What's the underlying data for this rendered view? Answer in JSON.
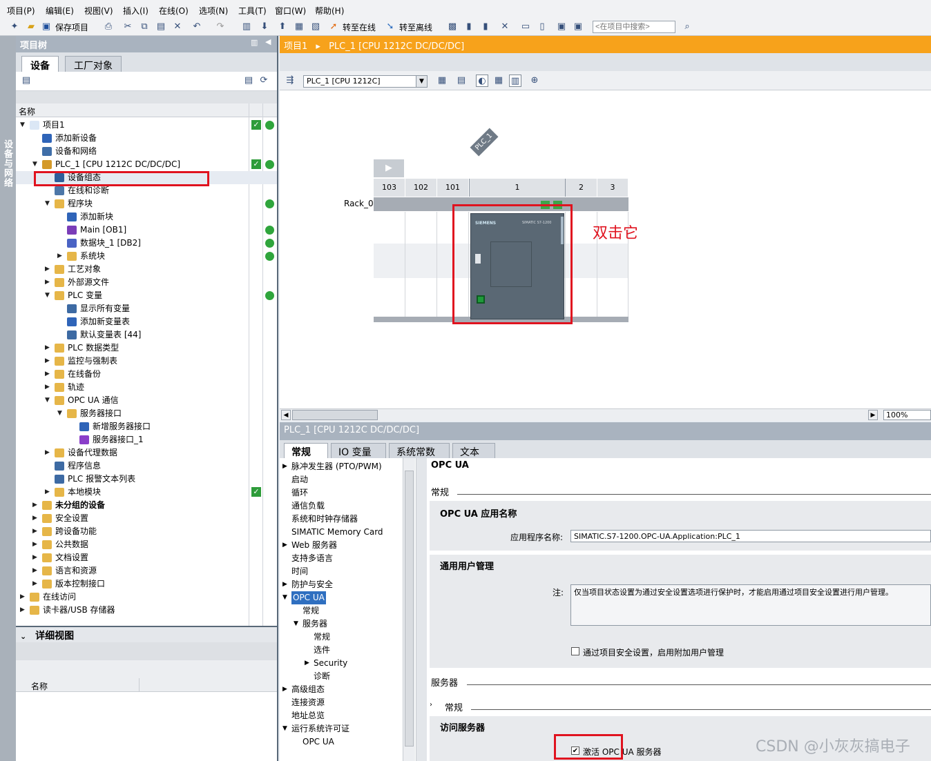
{
  "menu": [
    "项目(P)",
    "编辑(E)",
    "视图(V)",
    "插入(I)",
    "在线(O)",
    "选项(N)",
    "工具(T)",
    "窗口(W)",
    "帮助(H)"
  ],
  "toolbar": {
    "save_label": "保存项目",
    "go_online": "转至在线",
    "go_offline": "转至离线",
    "search_placeholder": "<在项目中搜索>"
  },
  "vstrip_label": "设备与网络",
  "project_tree": {
    "title": "项目树",
    "tab_devices": "设备",
    "tab_plant": "工厂对象",
    "col_name": "名称",
    "rows": [
      {
        "label": "项目1",
        "indent": 0,
        "arrow": "down",
        "icon": "project",
        "st1": true,
        "st2": true
      },
      {
        "label": "添加新设备",
        "indent": 1,
        "arrow": "",
        "icon": "add",
        "st1": false,
        "st2": false
      },
      {
        "label": "设备和网络",
        "indent": 1,
        "arrow": "",
        "icon": "network",
        "st1": false,
        "st2": false
      },
      {
        "label": "PLC_1 [CPU 1212C DC/DC/DC]",
        "indent": 1,
        "arrow": "down",
        "icon": "plc",
        "st1": true,
        "st2": true
      },
      {
        "label": "设备组态",
        "indent": 2,
        "arrow": "",
        "icon": "config",
        "st1": false,
        "st2": false
      },
      {
        "label": "在线和诊断",
        "indent": 2,
        "arrow": "",
        "icon": "diag",
        "st1": false,
        "st2": false
      },
      {
        "label": "程序块",
        "indent": 2,
        "arrow": "down",
        "icon": "folder",
        "st1": false,
        "st2": true
      },
      {
        "label": "添加新块",
        "indent": 3,
        "arrow": "",
        "icon": "add",
        "st1": false,
        "st2": false
      },
      {
        "label": "Main [OB1]",
        "indent": 3,
        "arrow": "",
        "icon": "ob",
        "st1": false,
        "st2": true
      },
      {
        "label": "数据块_1 [DB2]",
        "indent": 3,
        "arrow": "",
        "icon": "db",
        "st1": false,
        "st2": true
      },
      {
        "label": "系统块",
        "indent": 3,
        "arrow": "right",
        "icon": "folder",
        "st1": false,
        "st2": true
      },
      {
        "label": "工艺对象",
        "indent": 2,
        "arrow": "right",
        "icon": "folder",
        "st1": false,
        "st2": false
      },
      {
        "label": "外部源文件",
        "indent": 2,
        "arrow": "right",
        "icon": "folder",
        "st1": false,
        "st2": false
      },
      {
        "label": "PLC 变量",
        "indent": 2,
        "arrow": "down",
        "icon": "folder",
        "st1": false,
        "st2": true
      },
      {
        "label": "显示所有变量",
        "indent": 3,
        "arrow": "",
        "icon": "table",
        "st1": false,
        "st2": false
      },
      {
        "label": "添加新变量表",
        "indent": 3,
        "arrow": "",
        "icon": "add",
        "st1": false,
        "st2": false
      },
      {
        "label": "默认变量表 [44]",
        "indent": 3,
        "arrow": "",
        "icon": "table",
        "st1": false,
        "st2": false
      },
      {
        "label": "PLC 数据类型",
        "indent": 2,
        "arrow": "right",
        "icon": "folder",
        "st1": false,
        "st2": false
      },
      {
        "label": "监控与强制表",
        "indent": 2,
        "arrow": "right",
        "icon": "folder",
        "st1": false,
        "st2": false
      },
      {
        "label": "在线备份",
        "indent": 2,
        "arrow": "right",
        "icon": "folder",
        "st1": false,
        "st2": false
      },
      {
        "label": "轨迹",
        "indent": 2,
        "arrow": "right",
        "icon": "folder",
        "st1": false,
        "st2": false
      },
      {
        "label": "OPC UA 通信",
        "indent": 2,
        "arrow": "down",
        "icon": "folder",
        "st1": false,
        "st2": false
      },
      {
        "label": "服务器接口",
        "indent": 3,
        "arrow": "down",
        "icon": "folder",
        "st1": false,
        "st2": false
      },
      {
        "label": "新增服务器接口",
        "indent": 4,
        "arrow": "",
        "icon": "add",
        "st1": false,
        "st2": false
      },
      {
        "label": "服务器接口_1",
        "indent": 4,
        "arrow": "",
        "icon": "server",
        "st1": false,
        "st2": false
      },
      {
        "label": "设备代理数据",
        "indent": 2,
        "arrow": "right",
        "icon": "folder",
        "st1": false,
        "st2": false
      },
      {
        "label": "程序信息",
        "indent": 2,
        "arrow": "",
        "icon": "table",
        "st1": false,
        "st2": false
      },
      {
        "label": "PLC 报警文本列表",
        "indent": 2,
        "arrow": "",
        "icon": "table",
        "st1": false,
        "st2": false
      },
      {
        "label": "本地模块",
        "indent": 2,
        "arrow": "right",
        "icon": "folder",
        "st1": true,
        "st2": false
      },
      {
        "label": "未分组的设备",
        "indent": 1,
        "arrow": "right",
        "icon": "folder",
        "st1": false,
        "st2": false,
        "bold": true
      },
      {
        "label": "安全设置",
        "indent": 1,
        "arrow": "right",
        "icon": "folder",
        "st1": false,
        "st2": false
      },
      {
        "label": "跨设备功能",
        "indent": 1,
        "arrow": "right",
        "icon": "folder",
        "st1": false,
        "st2": false
      },
      {
        "label": "公共数据",
        "indent": 1,
        "arrow": "right",
        "icon": "folder",
        "st1": false,
        "st2": false
      },
      {
        "label": "文档设置",
        "indent": 1,
        "arrow": "right",
        "icon": "folder",
        "st1": false,
        "st2": false
      },
      {
        "label": "语言和资源",
        "indent": 1,
        "arrow": "right",
        "icon": "folder",
        "st1": false,
        "st2": false
      },
      {
        "label": "版本控制接口",
        "indent": 1,
        "arrow": "right",
        "icon": "folder",
        "st1": false,
        "st2": false
      },
      {
        "label": "在线访问",
        "indent": 0,
        "arrow": "right",
        "icon": "folder",
        "st1": false,
        "st2": false
      },
      {
        "label": "读卡器/USB 存储器",
        "indent": 0,
        "arrow": "right",
        "icon": "folder",
        "st1": false,
        "st2": false
      }
    ]
  },
  "detail_view": {
    "title": "详细视图",
    "col_name": "名称"
  },
  "device_view": {
    "breadcrumb_project": "项目1",
    "breadcrumb_sep": "▸",
    "breadcrumb_device": "PLC_1 [CPU 1212C DC/DC/DC]",
    "plc_select": "PLC_1 [CPU 1212C]",
    "device_tag": "PLC_1",
    "rack_label": "Rack_0",
    "slots": [
      "103",
      "102",
      "101",
      "1",
      "2",
      "3"
    ],
    "cpu_brand": "SIEMENS",
    "cpu_model": "SIMATIC S7-1200",
    "zoom": "100%"
  },
  "inspector": {
    "title": "PLC_1 [CPU 1212C DC/DC/DC]",
    "tabs": [
      "常规",
      "IO 变量",
      "系统常数",
      "文本"
    ],
    "nav": [
      {
        "label": "脉冲发生器 (PTO/PWM)",
        "indent": 0,
        "arrow": "right"
      },
      {
        "label": "启动",
        "indent": 0,
        "arrow": ""
      },
      {
        "label": "循环",
        "indent": 0,
        "arrow": ""
      },
      {
        "label": "通信负载",
        "indent": 0,
        "arrow": ""
      },
      {
        "label": "系统和时钟存储器",
        "indent": 0,
        "arrow": ""
      },
      {
        "label": "SIMATIC Memory Card",
        "indent": 0,
        "arrow": ""
      },
      {
        "label": "Web 服务器",
        "indent": 0,
        "arrow": "right"
      },
      {
        "label": "支持多语言",
        "indent": 0,
        "arrow": ""
      },
      {
        "label": "时间",
        "indent": 0,
        "arrow": ""
      },
      {
        "label": "防护与安全",
        "indent": 0,
        "arrow": "right"
      },
      {
        "label": "OPC UA",
        "indent": 0,
        "arrow": "down",
        "selected": true
      },
      {
        "label": "常规",
        "indent": 1,
        "arrow": ""
      },
      {
        "label": "服务器",
        "indent": 1,
        "arrow": "down"
      },
      {
        "label": "常规",
        "indent": 2,
        "arrow": ""
      },
      {
        "label": "选件",
        "indent": 2,
        "arrow": ""
      },
      {
        "label": "Security",
        "indent": 2,
        "arrow": "right"
      },
      {
        "label": "诊断",
        "indent": 2,
        "arrow": ""
      },
      {
        "label": "高级组态",
        "indent": 0,
        "arrow": "right"
      },
      {
        "label": "连接资源",
        "indent": 0,
        "arrow": ""
      },
      {
        "label": "地址总览",
        "indent": 0,
        "arrow": ""
      },
      {
        "label": "运行系统许可证",
        "indent": 0,
        "arrow": "down"
      },
      {
        "label": "OPC UA",
        "indent": 1,
        "arrow": ""
      }
    ],
    "content": {
      "heading": "OPC UA",
      "general": "常规",
      "app_name_section": "OPC UA 应用名称",
      "app_name_label": "应用程序名称:",
      "app_name_value": "SIMATIC.S7-1200.OPC-UA.Application:PLC_1",
      "user_mgmt_section": "通用用户管理",
      "note_label": "注:",
      "note_text": "仅当项目状态设置为通过安全设置选项进行保护时，才能启用通过项目安全设置进行用户管理。",
      "enable_user_mgmt": "通过项目安全设置，启用附加用户管理",
      "server_heading": "服务器",
      "server_general": "常规",
      "access_server_section": "访问服务器",
      "activate_server": "激活 OPC UA 服务器"
    }
  },
  "annotation": "双击它",
  "watermark": "CSDN @小灰灰搞电子"
}
